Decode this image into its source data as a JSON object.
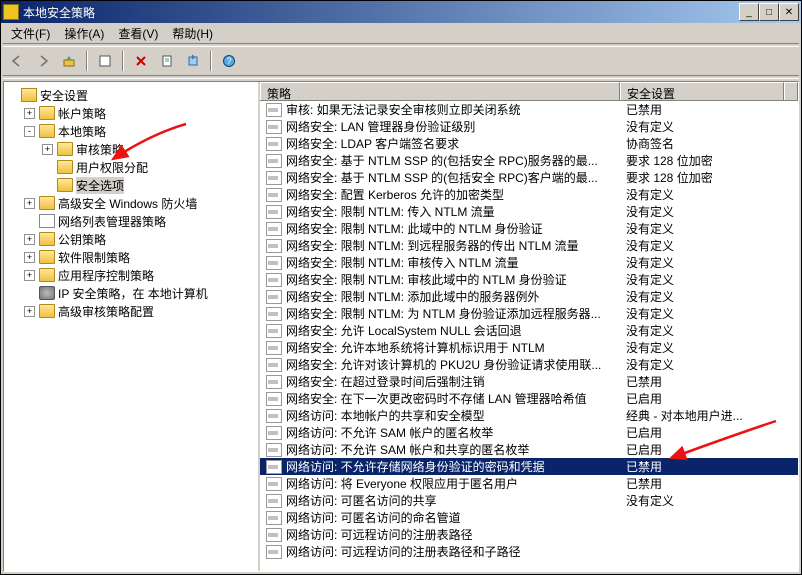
{
  "window": {
    "title": "本地安全策略"
  },
  "menu": {
    "file": "文件(F)",
    "action": "操作(A)",
    "view": "查看(V)",
    "help": "帮助(H)"
  },
  "tree": {
    "root": "安全设置",
    "nodes": [
      {
        "label": "帐户策略",
        "exp": "+",
        "icon": "folder"
      },
      {
        "label": "本地策略",
        "exp": "-",
        "icon": "folder",
        "children": [
          {
            "label": "审核策略",
            "exp": "+",
            "icon": "folder"
          },
          {
            "label": "用户权限分配",
            "exp": "",
            "icon": "folder"
          },
          {
            "label": "安全选项",
            "exp": "",
            "icon": "folder",
            "selected": true
          }
        ]
      },
      {
        "label": "高级安全 Windows 防火墙",
        "exp": "+",
        "icon": "folder"
      },
      {
        "label": "网络列表管理器策略",
        "exp": "",
        "icon": "doc"
      },
      {
        "label": "公钥策略",
        "exp": "+",
        "icon": "folder"
      },
      {
        "label": "软件限制策略",
        "exp": "+",
        "icon": "folder"
      },
      {
        "label": "应用程序控制策略",
        "exp": "+",
        "icon": "folder"
      },
      {
        "label": "IP 安全策略，在 本地计算机",
        "exp": "",
        "icon": "gear"
      },
      {
        "label": "高级审核策略配置",
        "exp": "+",
        "icon": "folder"
      }
    ]
  },
  "list": {
    "columns": {
      "policy": "策略",
      "setting": "安全设置"
    },
    "rows": [
      {
        "p": "审核: 如果无法记录安全审核则立即关闭系统",
        "s": "已禁用"
      },
      {
        "p": "网络安全: LAN 管理器身份验证级别",
        "s": "没有定义"
      },
      {
        "p": "网络安全: LDAP 客户端签名要求",
        "s": "协商签名"
      },
      {
        "p": "网络安全: 基于 NTLM SSP 的(包括安全 RPC)服务器的最...",
        "s": "要求 128 位加密"
      },
      {
        "p": "网络安全: 基于 NTLM SSP 的(包括安全 RPC)客户端的最...",
        "s": "要求 128 位加密"
      },
      {
        "p": "网络安全: 配置 Kerberos 允许的加密类型",
        "s": "没有定义"
      },
      {
        "p": "网络安全: 限制 NTLM: 传入 NTLM 流量",
        "s": "没有定义"
      },
      {
        "p": "网络安全: 限制 NTLM: 此域中的 NTLM 身份验证",
        "s": "没有定义"
      },
      {
        "p": "网络安全: 限制 NTLM: 到远程服务器的传出 NTLM 流量",
        "s": "没有定义"
      },
      {
        "p": "网络安全: 限制 NTLM: 审核传入 NTLM 流量",
        "s": "没有定义"
      },
      {
        "p": "网络安全: 限制 NTLM: 审核此域中的 NTLM 身份验证",
        "s": "没有定义"
      },
      {
        "p": "网络安全: 限制 NTLM: 添加此域中的服务器例外",
        "s": "没有定义"
      },
      {
        "p": "网络安全: 限制 NTLM: 为 NTLM 身份验证添加远程服务器...",
        "s": "没有定义"
      },
      {
        "p": "网络安全: 允许 LocalSystem NULL 会话回退",
        "s": "没有定义"
      },
      {
        "p": "网络安全: 允许本地系统将计算机标识用于 NTLM",
        "s": "没有定义"
      },
      {
        "p": "网络安全: 允许对该计算机的 PKU2U 身份验证请求使用联...",
        "s": "没有定义"
      },
      {
        "p": "网络安全: 在超过登录时间后强制注销",
        "s": "已禁用"
      },
      {
        "p": "网络安全: 在下一次更改密码时不存储 LAN 管理器哈希值",
        "s": "已启用"
      },
      {
        "p": "网络访问: 本地帐户的共享和安全模型",
        "s": "经典 - 对本地用户进..."
      },
      {
        "p": "网络访问: 不允许 SAM 帐户的匿名枚举",
        "s": "已启用"
      },
      {
        "p": "网络访问: 不允许 SAM 帐户和共享的匿名枚举",
        "s": "已启用"
      },
      {
        "p": "网络访问: 不允许存储网络身份验证的密码和凭据",
        "s": "已禁用",
        "selected": true
      },
      {
        "p": "网络访问: 将 Everyone 权限应用于匿名用户",
        "s": "已禁用"
      },
      {
        "p": "网络访问: 可匿名访问的共享",
        "s": "没有定义"
      },
      {
        "p": "网络访问: 可匿名访问的命名管道",
        "s": ""
      },
      {
        "p": "网络访问: 可远程访问的注册表路径",
        "s": ""
      },
      {
        "p": "网络访问: 可远程访问的注册表路径和子路径",
        "s": ""
      }
    ]
  }
}
